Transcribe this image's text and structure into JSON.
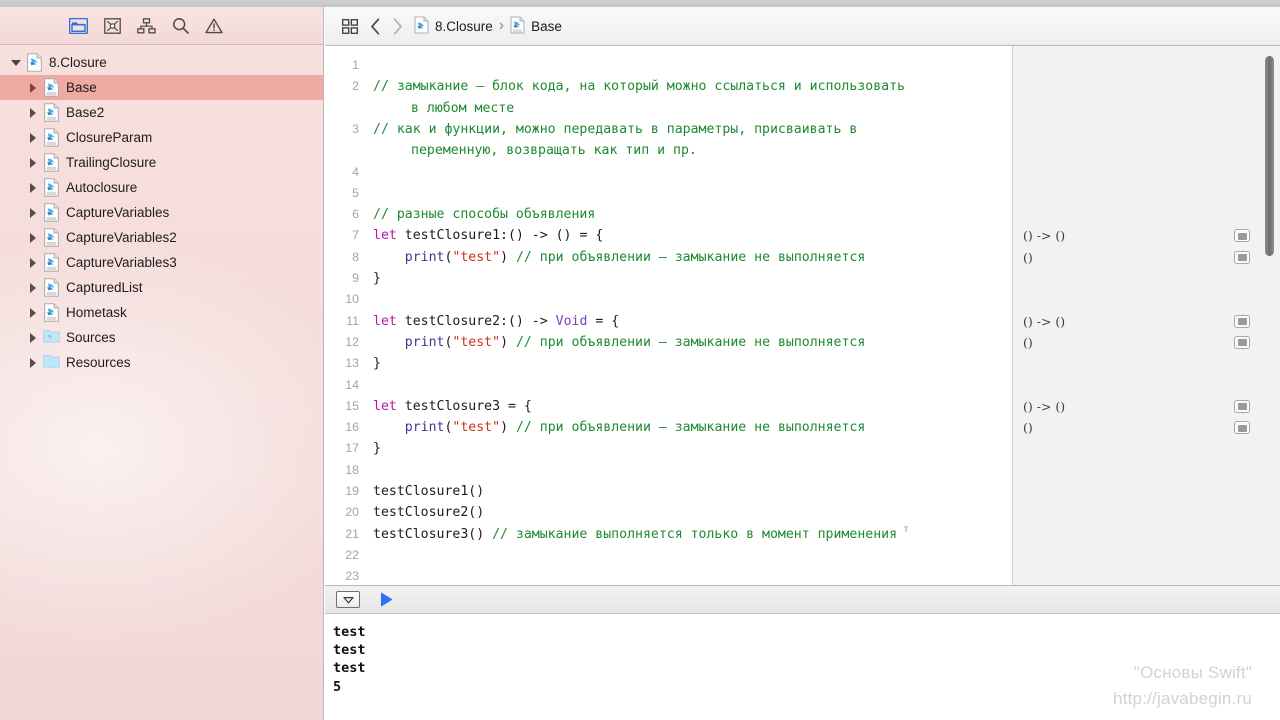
{
  "navigator": {
    "toolbar_icons": [
      {
        "name": "folder-icon",
        "label": "Project navigator",
        "selected": true
      },
      {
        "name": "source-control-icon",
        "label": "Source control navigator",
        "selected": false
      },
      {
        "name": "hierarchy-icon",
        "label": "Symbol navigator",
        "selected": false
      },
      {
        "name": "search-icon",
        "label": "Find navigator",
        "selected": false
      },
      {
        "name": "warning-icon",
        "label": "Issue navigator",
        "selected": false
      }
    ],
    "tree": [
      {
        "label": "8.Closure",
        "icon": "playground-icon",
        "depth": 0,
        "expanded": true,
        "selected": false
      },
      {
        "label": "Base",
        "icon": "playground-page-icon",
        "depth": 1,
        "expanded": false,
        "selected": true
      },
      {
        "label": "Base2",
        "icon": "playground-page-icon",
        "depth": 1,
        "expanded": false,
        "selected": false
      },
      {
        "label": "ClosureParam",
        "icon": "playground-page-icon",
        "depth": 1,
        "expanded": false,
        "selected": false
      },
      {
        "label": "TrailingClosure",
        "icon": "playground-page-icon",
        "depth": 1,
        "expanded": false,
        "selected": false
      },
      {
        "label": "Autoclosure",
        "icon": "playground-page-icon",
        "depth": 1,
        "expanded": false,
        "selected": false
      },
      {
        "label": "CaptureVariables",
        "icon": "playground-page-icon",
        "depth": 1,
        "expanded": false,
        "selected": false
      },
      {
        "label": "CaptureVariables2",
        "icon": "playground-page-icon",
        "depth": 1,
        "expanded": false,
        "selected": false
      },
      {
        "label": "CaptureVariables3",
        "icon": "playground-page-icon",
        "depth": 1,
        "expanded": false,
        "selected": false
      },
      {
        "label": "CapturedList",
        "icon": "playground-page-icon",
        "depth": 1,
        "expanded": false,
        "selected": false
      },
      {
        "label": "Hometask",
        "icon": "playground-page-icon",
        "depth": 1,
        "expanded": false,
        "selected": false
      },
      {
        "label": "Sources",
        "icon": "sources-folder-icon",
        "depth": 1,
        "expanded": false,
        "selected": false
      },
      {
        "label": "Resources",
        "icon": "resources-folder-icon",
        "depth": 1,
        "expanded": false,
        "selected": false
      }
    ]
  },
  "breadcrumb": {
    "grid_icon": "related-items-icon",
    "back_icon": "chevron-left-icon",
    "forward_icon": "chevron-right-icon",
    "project": "8.Closure",
    "separator": "›",
    "page": "Base"
  },
  "editor": {
    "lines": [
      {
        "n": "1",
        "tall": false,
        "tokens": []
      },
      {
        "n": "2",
        "tall": true,
        "tokens": [
          {
            "c": "cmt",
            "t": "// замыкание — блок кода, на который можно ссылаться и использовать"
          }
        ],
        "cont": [
          {
            "c": "cmt",
            "t": "в любом месте"
          }
        ]
      },
      {
        "n": "3",
        "tall": true,
        "tokens": [
          {
            "c": "cmt",
            "t": "// как и функции, можно передавать в параметры, присваивать в"
          }
        ],
        "cont": [
          {
            "c": "cmt",
            "t": "переменную, возвращать как тип и пр."
          }
        ]
      },
      {
        "n": "4",
        "tall": false,
        "tokens": []
      },
      {
        "n": "5",
        "tall": false,
        "tokens": []
      },
      {
        "n": "6",
        "tall": false,
        "tokens": [
          {
            "c": "cmt",
            "t": "// разные способы объявления"
          }
        ]
      },
      {
        "n": "7",
        "tall": false,
        "tokens": [
          {
            "c": "kw",
            "t": "let"
          },
          {
            "c": "pln",
            "t": " testClosure1:() -> () = {"
          }
        ]
      },
      {
        "n": "8",
        "tall": false,
        "tokens": [
          {
            "c": "fn",
            "t": "    print"
          },
          {
            "c": "pln",
            "t": "("
          },
          {
            "c": "str",
            "t": "\"test\""
          },
          {
            "c": "pln",
            "t": ") "
          },
          {
            "c": "cmt",
            "t": "// при объявлении — замыкание не выполняется"
          }
        ]
      },
      {
        "n": "9",
        "tall": false,
        "tokens": [
          {
            "c": "pln",
            "t": "}"
          }
        ]
      },
      {
        "n": "10",
        "tall": false,
        "tokens": []
      },
      {
        "n": "11",
        "tall": false,
        "tokens": [
          {
            "c": "kw",
            "t": "let"
          },
          {
            "c": "pln",
            "t": " testClosure2:() -> "
          },
          {
            "c": "typ",
            "t": "Void"
          },
          {
            "c": "pln",
            "t": " = {"
          }
        ]
      },
      {
        "n": "12",
        "tall": false,
        "tokens": [
          {
            "c": "fn",
            "t": "    print"
          },
          {
            "c": "pln",
            "t": "("
          },
          {
            "c": "str",
            "t": "\"test\""
          },
          {
            "c": "pln",
            "t": ") "
          },
          {
            "c": "cmt",
            "t": "// при объявлении — замыкание не выполняется"
          }
        ]
      },
      {
        "n": "13",
        "tall": false,
        "tokens": [
          {
            "c": "pln",
            "t": "}"
          }
        ]
      },
      {
        "n": "14",
        "tall": false,
        "tokens": []
      },
      {
        "n": "15",
        "tall": false,
        "tokens": [
          {
            "c": "kw",
            "t": "let"
          },
          {
            "c": "pln",
            "t": " testClosure3 = {"
          }
        ]
      },
      {
        "n": "16",
        "tall": false,
        "tokens": [
          {
            "c": "fn",
            "t": "    print"
          },
          {
            "c": "pln",
            "t": "("
          },
          {
            "c": "str",
            "t": "\"test\""
          },
          {
            "c": "pln",
            "t": ") "
          },
          {
            "c": "cmt",
            "t": "// при объявлении — замыкание не выполняется"
          }
        ]
      },
      {
        "n": "17",
        "tall": false,
        "tokens": [
          {
            "c": "pln",
            "t": "}"
          }
        ]
      },
      {
        "n": "18",
        "tall": false,
        "tokens": []
      },
      {
        "n": "19",
        "tall": false,
        "tokens": [
          {
            "c": "pln",
            "t": "testClosure1()"
          }
        ]
      },
      {
        "n": "20",
        "tall": false,
        "tokens": [
          {
            "c": "pln",
            "t": "testClosure2()"
          }
        ]
      },
      {
        "n": "21",
        "tall": false,
        "tokens": [
          {
            "c": "pln",
            "t": "testClosure3() "
          },
          {
            "c": "cmt",
            "t": "// замыкание выполняется только в момент применения"
          }
        ]
      },
      {
        "n": "22",
        "tall": false,
        "tokens": []
      },
      {
        "n": "23",
        "tall": false,
        "tokens": []
      }
    ],
    "cursor_hint": "т"
  },
  "results": [
    {
      "line": 7,
      "value": "() -> ()",
      "quicklook": true
    },
    {
      "line": 8,
      "value": "()",
      "quicklook": true
    },
    {
      "line": 11,
      "value": "() -> ()",
      "quicklook": true
    },
    {
      "line": 12,
      "value": "()",
      "quicklook": true
    },
    {
      "line": 15,
      "value": "() -> ()",
      "quicklook": true
    },
    {
      "line": 16,
      "value": "()",
      "quicklook": true
    }
  ],
  "console_bar": {
    "dropdown_icon": "chevron-down-box-icon",
    "play_icon": "play-icon"
  },
  "console_output": [
    "test",
    "test",
    "test",
    "5"
  ],
  "watermark": {
    "line1": "\"Основы Swift\"",
    "line2": "http://javabegin.ru"
  },
  "colors": {
    "navigator_bg": "#f4dcda",
    "selected_row": "#eeaaa3",
    "keyword": "#b5179e",
    "type": "#7a3fb8",
    "string": "#d12f1b",
    "comment": "#1d8a32",
    "function": "#3b3a8f",
    "accent_blue": "#2d6ff5"
  }
}
